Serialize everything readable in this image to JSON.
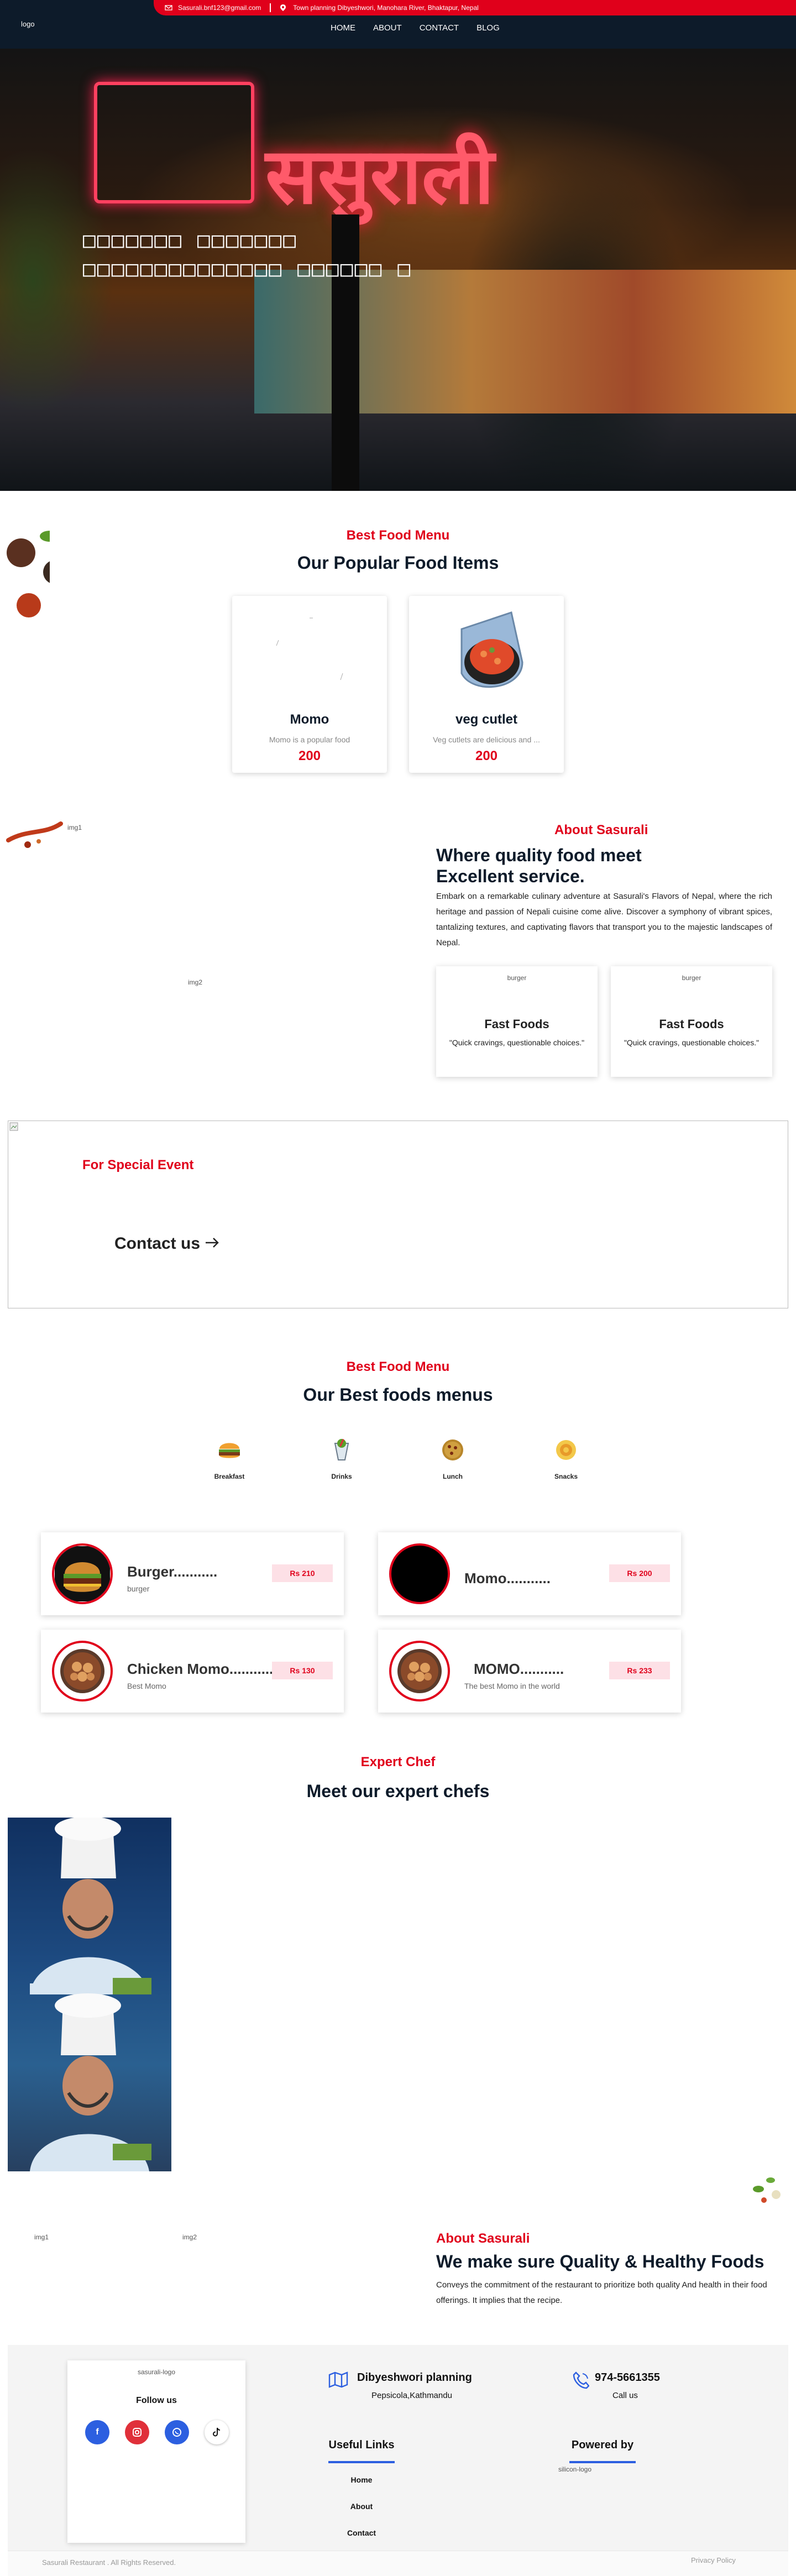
{
  "header": {
    "email": "Sasurali.bnf123@gmail.com",
    "address": "Town planning Dibyeshwori, Manohara River, Bhaktapur, Nepal",
    "logo_alt": "logo",
    "nav": [
      "HOME",
      "ABOUT",
      "CONTACT",
      "BLOG"
    ]
  },
  "hero": {
    "line1": "□□□□□□□ □□□□□□□",
    "line2": "□□□□□□□□□□□□□□ □□□□□□ □",
    "sign_text": "ससुराली"
  },
  "popular": {
    "kicker": "Best Food Menu",
    "headline": "Our Popular Food Items",
    "items": [
      {
        "name": "Momo",
        "desc": "Momo is a popular food",
        "price": "200"
      },
      {
        "name": "veg cutlet",
        "desc": "Veg cutlets are delicious and ...",
        "price": "200"
      }
    ]
  },
  "about1": {
    "title": "About Sasurali",
    "headline_line1": "Where quality food meet",
    "headline_line2": "Excellent service.",
    "paragraph": "Embark on a remarkable culinary adventure at Sasurali's Flavors of Nepal, where the rich heritage and passion of Nepali cuisine come alive. Discover a symphony of vibrant spices, tantalizing textures, and captivating flavors that transport you to the majestic landscapes of Nepal.",
    "img1_alt": "img1",
    "img2_alt": "img2",
    "cards": [
      {
        "img_alt": "burger",
        "title": "Fast Foods",
        "quote": "\"Quick cravings, questionable choices.\""
      },
      {
        "img_alt": "burger",
        "title": "Fast Foods",
        "quote": "\"Quick cravings, questionable choices.\""
      }
    ]
  },
  "event": {
    "title": "For Special Event",
    "cta": "Contact us"
  },
  "menus": {
    "kicker": "Best Food Menu",
    "headline": "Our Best foods menus",
    "categories": [
      "Breakfast",
      "Drinks",
      "Lunch",
      "Snacks"
    ],
    "items": [
      {
        "name": "Burger...........",
        "sub": "burger",
        "price": "Rs 210"
      },
      {
        "name": "Momo...........",
        "sub": "",
        "price": "Rs 200"
      },
      {
        "name": "Chicken Momo...........",
        "sub": "Best Momo",
        "price": "Rs 130"
      },
      {
        "name": "MOMO...........",
        "sub": "The best Momo in the world",
        "price": "Rs 233"
      }
    ]
  },
  "chefs": {
    "kicker": "Expert Chef",
    "headline": "Meet our expert chefs"
  },
  "about2": {
    "title": "About Sasurali",
    "headline": "We make sure Quality & Healthy Foods",
    "paragraph": "Conveys the commitment of the restaurant to prioritize both quality And health in their food offerings. It implies that the recipe.",
    "img1_alt": "img1",
    "img2_alt": "img2"
  },
  "footer": {
    "logo_alt": "sasurali-logo",
    "follow": "Follow us",
    "location_title": "Dibyeshwori planning",
    "location_sub": "Pepsicola,Kathmandu",
    "phone": "974-5661355",
    "phone_sub": "Call us",
    "useful_links": "Useful Links",
    "links": [
      "Home",
      "About",
      "Contact"
    ],
    "powered_by": "Powered by",
    "silicon_alt": "silicon-logo",
    "copyright": "Sasurali Restaurant . All Rights Reserved.",
    "privacy": "Privacy Policy"
  },
  "colors": {
    "accent": "#e0001b",
    "navy": "#0d1b2a"
  }
}
